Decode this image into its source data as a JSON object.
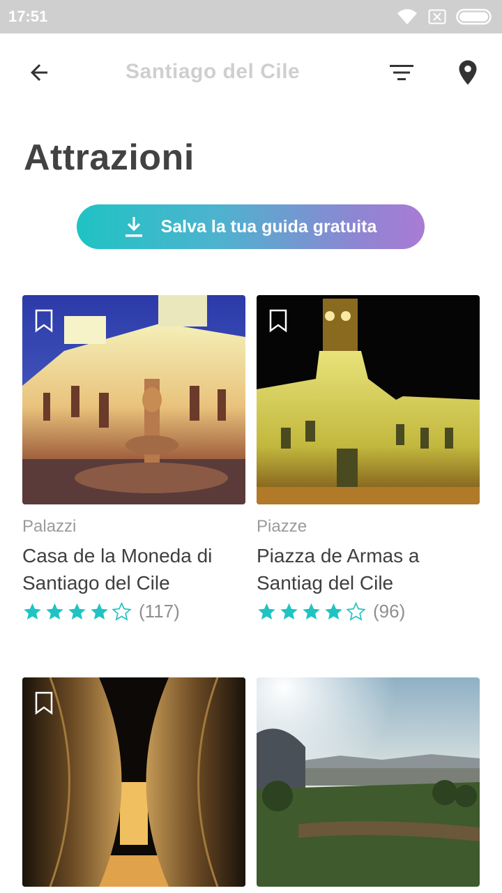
{
  "status_bar": {
    "time": "17:51",
    "icons": [
      "wifi-icon",
      "no-sim-icon",
      "battery-icon"
    ]
  },
  "toolbar": {
    "title": "Santiago del Cile",
    "back_icon": "arrow-back-icon",
    "filter_icon": "filter-icon",
    "map_icon": "map-pin-icon"
  },
  "page": {
    "title": "Attrazioni"
  },
  "cta": {
    "label": "Salva la tua guida gratuita",
    "icon": "download-icon",
    "colors": [
      "#1fc3c3",
      "#a97bd4"
    ]
  },
  "colors": {
    "star": "#1fc3c3",
    "status_bar": "#cfcfcf"
  },
  "attractions": [
    {
      "category": "Palazzi",
      "title": "Casa de la Moneda di Santiago del Cile",
      "rating": 4,
      "rating_count": "(117)",
      "bookmarked": false
    },
    {
      "category": "Piazze",
      "title": "Piazza de Armas a Santiag del Cile",
      "rating": 4,
      "rating_count": "(96)",
      "bookmarked": false
    },
    {
      "category": "",
      "title": "",
      "rating": null,
      "rating_count": "",
      "bookmarked": false
    },
    {
      "category": "",
      "title": "",
      "rating": null,
      "rating_count": "",
      "bookmarked": false
    }
  ]
}
